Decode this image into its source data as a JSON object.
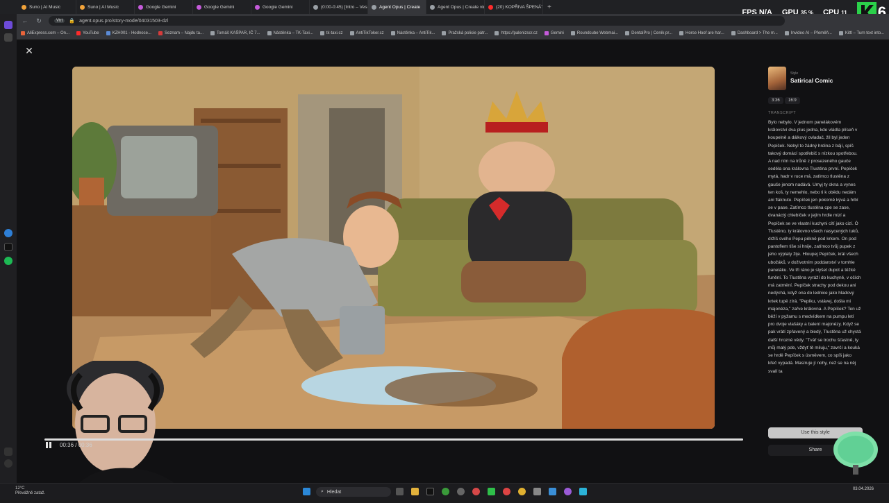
{
  "browser": {
    "tabs": [
      {
        "title": "Suno | AI Music",
        "color": "#f2a33a"
      },
      {
        "title": "Suno | AI Music",
        "color": "#f2a33a"
      },
      {
        "title": "Google Gemini",
        "color": "#c65bdb"
      },
      {
        "title": "Google Gemini",
        "color": "#c65bdb"
      },
      {
        "title": "Google Gemini",
        "color": "#c65bdb"
      },
      {
        "title": "(0:00-0:45) [Intro – Vesel",
        "color": "#9aa0a6"
      },
      {
        "title": "Agent Opus | Create",
        "color": "#9aa0a6",
        "active": true
      },
      {
        "title": "Agent Opus | Create vide",
        "color": "#9aa0a6"
      },
      {
        "title": "(20) KOPŘIVA ŠPENÁT - Yo",
        "color": "#ff2b2b"
      }
    ],
    "url_badge": "Vtrt",
    "url": "agent.opus.pro/story-mode/04031503-dzl",
    "bookmarks": [
      {
        "label": "AliExpress.com – On...",
        "color": "#e8643a"
      },
      {
        "label": "YouTube",
        "color": "#ff2b2b"
      },
      {
        "label": "KZH001 - Hodnoce...",
        "color": "#5b8bd6"
      },
      {
        "label": "Seznam – Najdu ta...",
        "color": "#d63b3b"
      },
      {
        "label": "Tomáš KAŠPAR, IČ 7...",
        "color": "#9aa0a6"
      },
      {
        "label": "Nástěnka – TK-Taxi...",
        "color": "#9aa0a6"
      },
      {
        "label": "tk-taxi.cz",
        "color": "#9aa0a6"
      },
      {
        "label": "AntiTikToker.cz",
        "color": "#9aa0a6"
      },
      {
        "label": "Nástěnka – AntiTik...",
        "color": "#9aa0a6"
      },
      {
        "label": "Pražská policie pátr...",
        "color": "#9aa0a6"
      },
      {
        "label": "https://palenizscr.cz",
        "color": "#9aa0a6"
      },
      {
        "label": "Gemini",
        "color": "#c65bdb"
      },
      {
        "label": "Roundcube Webmai...",
        "color": "#9aa0a6"
      },
      {
        "label": "DentalPro | Ceník pr...",
        "color": "#9aa0a6"
      },
      {
        "label": "Horse Hoof are har...",
        "color": "#9aa0a6"
      },
      {
        "label": "Dashboard > The m...",
        "color": "#9aa0a6"
      },
      {
        "label": "Invideo AI – Přeměň...",
        "color": "#9aa0a6"
      },
      {
        "label": "Kittl – Turn text into...",
        "color": "#9aa0a6"
      }
    ]
  },
  "overlay": {
    "fps_label": "FPS",
    "fps_value": "N/A",
    "gpu_label": "GPU",
    "gpu_value": "35 %",
    "cpu_label": "CPU",
    "cpu_value": "11",
    "channel_badge": "6"
  },
  "player": {
    "time": "00:36 / 00:36",
    "progress": 1.0
  },
  "panel": {
    "style_label": "Style",
    "style_name": "Satirical Comic",
    "duration": "3:36",
    "aspect": "16:9",
    "transcript_label": "TRANSCRIPT",
    "transcript": "Bylo nebylo. V jednom panelákovém království dva plus jedna, kde vládla plíseň v koupelně a dálkový ovladač, žil byl jeden Pepíček. Nebyl to žádný hrdina z bájí, spíš takový domácí spotřebič s nízkou spotřebou. A nad ním na trůně z prosezeného gauče seděla ona královna Tlustěna první. Pepíček mytá, hadr v ruce má, zatímco tlustěna z gauče jenom nadává. Umyj ty okna a vynes ten koš, ty nemehlo, nebo ti k obědu nedám ani fláknutu. Pepíček jen pokorně kývá a hrbí se v pase. Zatímco tlustěna cpe se zase, dvanáctý chlebíček v jejím hrdle mizí a Pepíček se ve vlastní kuchyni cítí jako cizí. Ó Tlustěno, ty královno všech nasycených tuků, držíš svého Pepu pěkně pod krkem. On pod pantoflem tiše si hnije, zatímco tvůj pupek z jeho výplaty žije. Hloupej Pepíček, král všech ubožáků, v doživotním poddanství v tomhle paneláku. Ve tři ráno je slyšet dupot a těžké funění. To Tlustěna vyráží do kuchyně, v očích má zatmění. Pepíček strachy pod dekou ani nedýchá, když ona do lednice jako hladový krtek tupě zírá. \"Pepíku, vstávej, došla mi majonéza,\" zařve královna. A Pepíček? Ten už běží v pyžamu s medvídkem na pumpu letí pro dvoje vlašáky a balení majonézy. Když se pak vrátí zpřavený a bledý, Tlustěna už chystá další hrozné vědy. \"Tvář se trochu šťastně, ty můj malý pde, vždyť tě miluju,\" zavrčí a kouká se hrdě Pepíček s úsměvem, co spíš jako křeč vypadá. Masíruje jí nohy, než se na něj svalí ta",
    "use_style_label": "Use this style",
    "share_label": "Share"
  },
  "taskbar": {
    "weather_temp": "12°C",
    "weather_desc": "Převážně zataž.",
    "search_placeholder": "Hledat",
    "clock_time": "",
    "clock_date": "03.04.2026"
  }
}
